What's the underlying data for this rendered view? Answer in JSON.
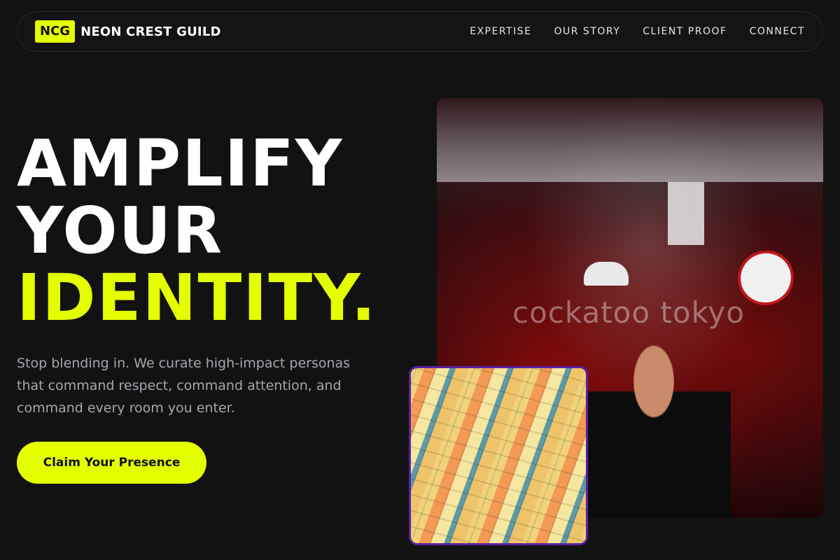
{
  "nav": {
    "logo_badge": "NCG",
    "logo_name": "NEON CREST GUILD",
    "links": [
      {
        "label": "EXPERTISE"
      },
      {
        "label": "OUR STORY"
      },
      {
        "label": "CLIENT PROOF"
      },
      {
        "label": "CONNECT"
      }
    ]
  },
  "hero": {
    "headline_lines": [
      "AMPLIFY",
      "YOUR",
      "IDENTITY."
    ],
    "lede": "Stop blending in. We curate high-impact personas that command respect, command attention, and command every room you enter.",
    "cta_label": "Claim Your Presence"
  },
  "images": {
    "main_watermark": "cockatoo tokyo"
  },
  "colors": {
    "accent": "#e3ff00",
    "background": "#121212",
    "inset_border": "#5b1fa3"
  }
}
